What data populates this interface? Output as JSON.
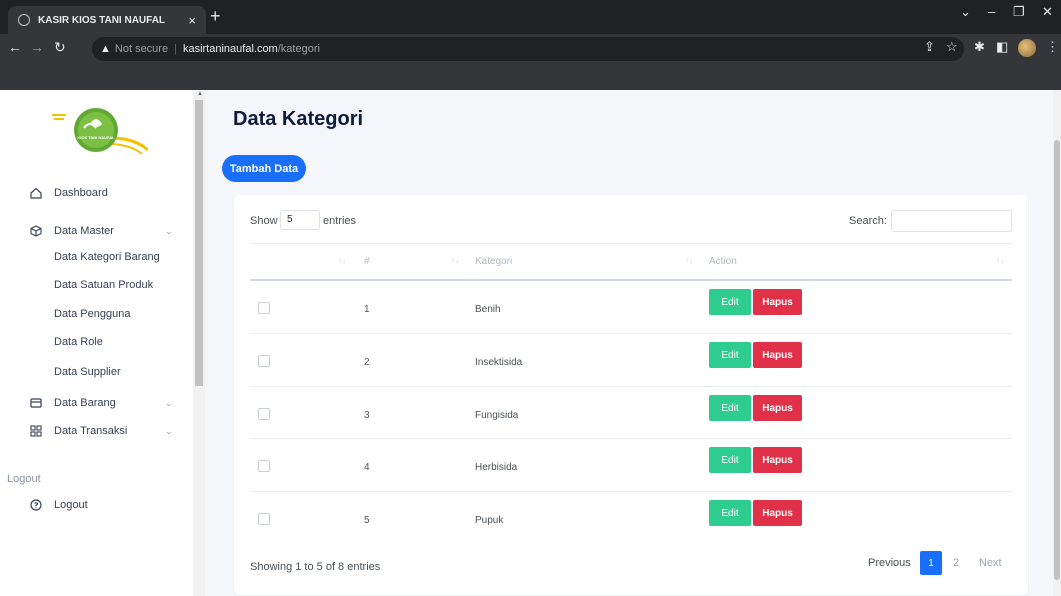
{
  "browser": {
    "tab_title": "KASIR KIOS TANI NAUFAL",
    "tab_close": "×",
    "new_tab": "+",
    "security": "Not secure",
    "url_host": "kasirtaninaufal.com",
    "url_path": "/kategori"
  },
  "logo": {
    "text": "KIOS TANI NAUFAL",
    "brand_color": "#6cb33f"
  },
  "sidebar": {
    "dashboard": "Dashboard",
    "data_master": "Data Master",
    "master_items": [
      "Data Kategori Barang",
      "Data Satuan Produk",
      "Data Pengguna",
      "Data Role",
      "Data Supplier"
    ],
    "data_barang": "Data Barang",
    "data_transaksi": "Data Transaksi",
    "section_logout": "Logout",
    "logout": "Logout"
  },
  "main": {
    "title": "Data Kategori",
    "add_button": "Tambah Data",
    "show_label": "Show",
    "show_value": "5",
    "entries_label": "entries",
    "search_label": "Search:",
    "columns": [
      "#",
      "Kategori",
      "Action"
    ],
    "rows": [
      {
        "no": "1",
        "kategori": "Benih"
      },
      {
        "no": "2",
        "kategori": "Insektisida"
      },
      {
        "no": "3",
        "kategori": "Fungisida"
      },
      {
        "no": "4",
        "kategori": "Herbisida"
      },
      {
        "no": "5",
        "kategori": "Pupuk"
      }
    ],
    "edit_label": "Edit",
    "delete_label": "Hapus",
    "info": "Showing 1 to 5 of 8 entries",
    "pagination": {
      "previous": "Previous",
      "page1": "1",
      "page2": "2",
      "next": "Next"
    }
  },
  "colors": {
    "primary": "#1a6efc",
    "edit": "#2ecc8f",
    "delete": "#e03149"
  }
}
